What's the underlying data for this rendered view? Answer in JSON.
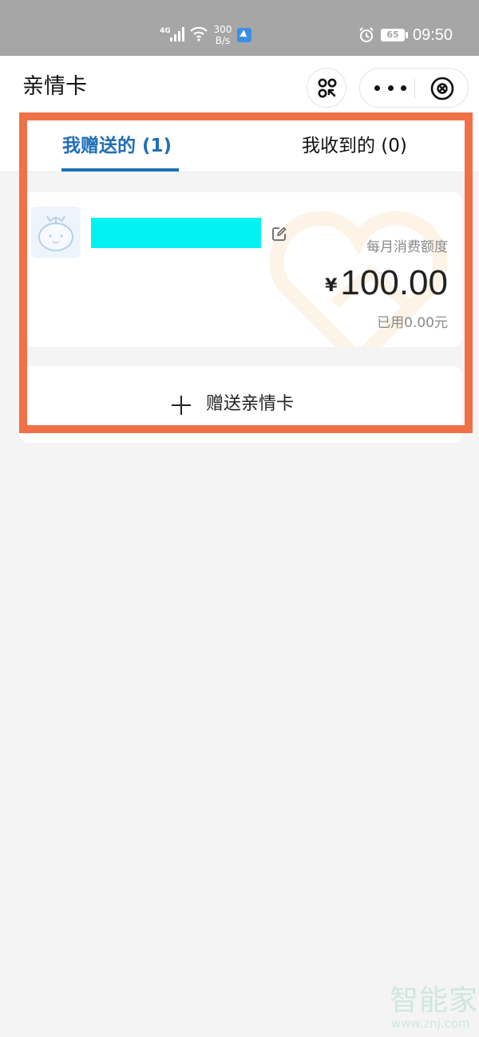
{
  "status_bar": {
    "network": "4G",
    "speed_value": "300",
    "speed_unit": "B/s",
    "battery": "65",
    "time": "09:50"
  },
  "nav": {
    "title": "亲情卡",
    "icons": {
      "scan": "scan-code-icon",
      "more": "more-dots-icon",
      "close": "close-circle-icon"
    }
  },
  "tabs": [
    {
      "label": "我赠送的 (1)",
      "active": true
    },
    {
      "label": "我收到的 (0)",
      "active": false
    }
  ],
  "card": {
    "limit_label": "每月消费额度",
    "currency": "¥",
    "amount": "100.00",
    "used": "已用0.00元",
    "name_redaction_color": "#00f3f0"
  },
  "gift_button": {
    "label": "赠送亲情卡"
  },
  "watermark": {
    "logo": "智能家",
    "url": "www.znj.com"
  },
  "colors": {
    "accent": "#1f6fb8",
    "highlight": "#f07147",
    "background": "#f4f4f4"
  }
}
